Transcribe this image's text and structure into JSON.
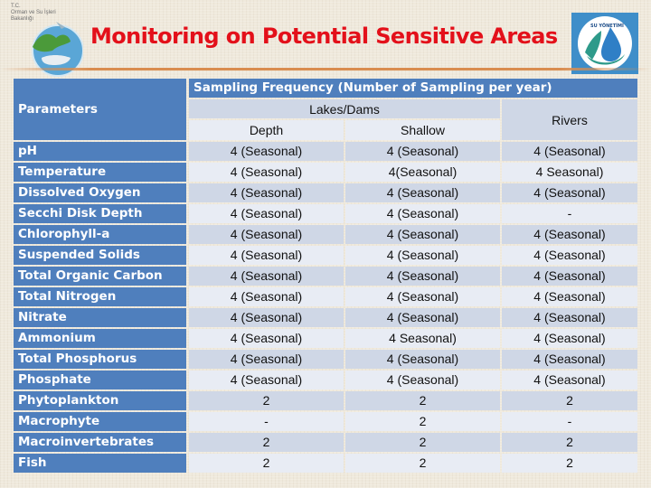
{
  "header": {
    "ministry_lines": [
      "T.C.",
      "Orman ve Su İşleri",
      "Bakanlığı"
    ],
    "title": "Monitoring on Potential Sensitive Areas",
    "left_logo": "ministry-globe-logo",
    "right_logo": "su-yonetimi-water-drop-logo",
    "right_logo_text": "SU YÖNETİMİ"
  },
  "colors": {
    "title": "#e3101a",
    "header_blue": "#4f7fbd",
    "row_dark": "#cfd7e6",
    "row_light": "#e8ecf4",
    "rule": "#d98d50"
  },
  "table": {
    "parameters_header": "Parameters",
    "frequency_header": "Sampling Frequency (Number of Sampling per year)",
    "lakes_header": "Lakes/Dams",
    "depth_header": "Depth",
    "shallow_header": "Shallow",
    "rivers_header": "Rivers",
    "rows": [
      {
        "parameter": "pH",
        "depth": "4 (Seasonal)",
        "shallow": "4 (Seasonal)",
        "rivers": "4 (Seasonal)"
      },
      {
        "parameter": "Temperature",
        "depth": "4 (Seasonal)",
        "shallow": "4(Seasonal)",
        "rivers": "4 Seasonal)"
      },
      {
        "parameter": "Dissolved Oxygen",
        "depth": "4 (Seasonal)",
        "shallow": "4 (Seasonal)",
        "rivers": "4 (Seasonal)"
      },
      {
        "parameter": "Secchi Disk Depth",
        "depth": "4 (Seasonal)",
        "shallow": "4 (Seasonal)",
        "rivers": "-"
      },
      {
        "parameter": "Chlorophyll-a",
        "depth": "4 (Seasonal)",
        "shallow": "4 (Seasonal)",
        "rivers": "4 (Seasonal)"
      },
      {
        "parameter": "Suspended Solids",
        "depth": "4 (Seasonal)",
        "shallow": "4 (Seasonal)",
        "rivers": "4 (Seasonal)"
      },
      {
        "parameter": "Total Organic Carbon",
        "depth": "4 (Seasonal)",
        "shallow": "4 (Seasonal)",
        "rivers": "4 (Seasonal)"
      },
      {
        "parameter": "Total Nitrogen",
        "depth": "4 (Seasonal)",
        "shallow": "4 (Seasonal)",
        "rivers": "4 (Seasonal)"
      },
      {
        "parameter": "Nitrate",
        "depth": "4 (Seasonal)",
        "shallow": "4 (Seasonal)",
        "rivers": "4 (Seasonal)"
      },
      {
        "parameter": "Ammonium",
        "depth": "4 (Seasonal)",
        "shallow": "4 Seasonal)",
        "rivers": "4 (Seasonal)"
      },
      {
        "parameter": "Total Phosphorus",
        "depth": "4 (Seasonal)",
        "shallow": "4 (Seasonal)",
        "rivers": "4 (Seasonal)"
      },
      {
        "parameter": "Phosphate",
        "depth": "4 (Seasonal)",
        "shallow": "4 (Seasonal)",
        "rivers": "4 (Seasonal)"
      },
      {
        "parameter": "Phytoplankton",
        "depth": "2",
        "shallow": "2",
        "rivers": "2"
      },
      {
        "parameter": "Macrophyte",
        "depth": "-",
        "shallow": "2",
        "rivers": "-"
      },
      {
        "parameter": "Macroinvertebrates",
        "depth": "2",
        "shallow": "2",
        "rivers": "2"
      },
      {
        "parameter": "Fish",
        "depth": "2",
        "shallow": "2",
        "rivers": "2"
      }
    ]
  }
}
